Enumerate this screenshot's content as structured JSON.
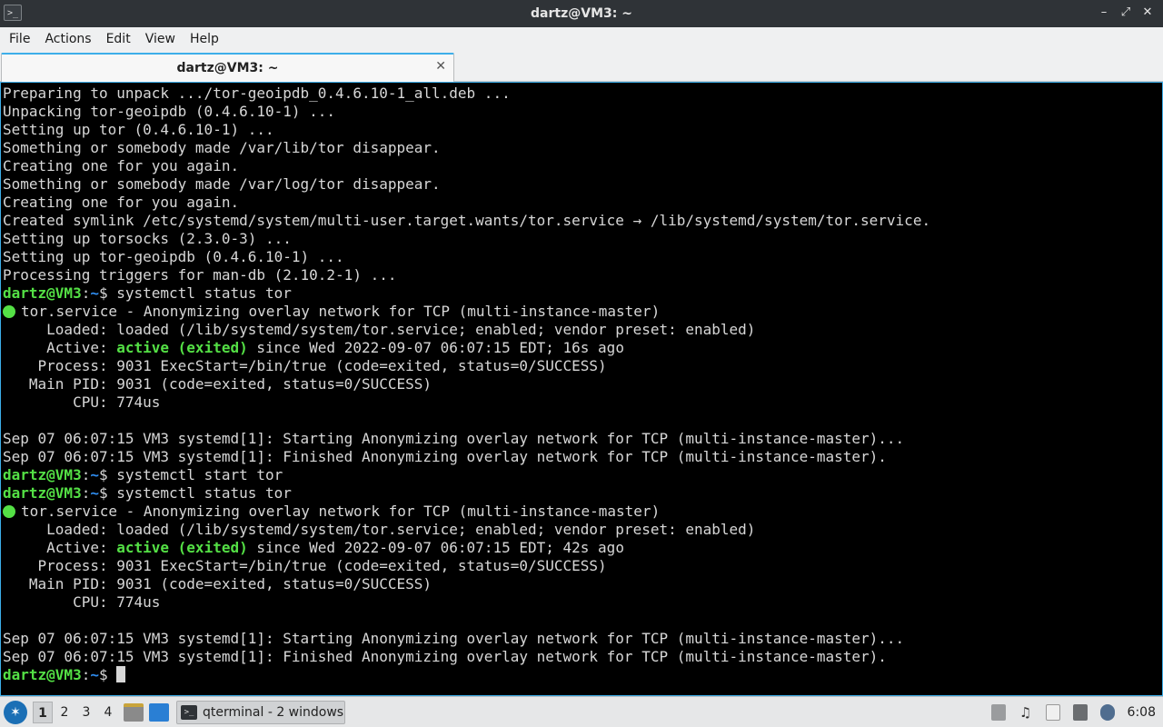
{
  "window": {
    "title": "dartz@VM3: ~",
    "app_icon_glyph": ">_",
    "controls": {
      "minimize": "–",
      "restore": "⤢",
      "close": "✕"
    }
  },
  "menu": [
    "File",
    "Actions",
    "Edit",
    "View",
    "Help"
  ],
  "tab": {
    "label": "dartz@VM3: ~",
    "close_glyph": "✕"
  },
  "terminal": {
    "colors": {
      "background": "#000000",
      "text": "#d7d7d7",
      "prompt_user": "#54e045",
      "prompt_path": "#2f8df0",
      "status_active": "#54e045"
    },
    "prompt": {
      "user_host": "dartz@VM3",
      "sep": ":",
      "path": "~",
      "symbol": "$"
    },
    "lines": [
      {
        "t": "Preparing to unpack .../tor-geoipdb_0.4.6.10-1_all.deb ..."
      },
      {
        "t": "Unpacking tor-geoipdb (0.4.6.10-1) ..."
      },
      {
        "t": "Setting up tor (0.4.6.10-1) ..."
      },
      {
        "t": "Something or somebody made /var/lib/tor disappear."
      },
      {
        "t": "Creating one for you again."
      },
      {
        "t": "Something or somebody made /var/log/tor disappear."
      },
      {
        "t": "Creating one for you again."
      },
      {
        "t": "Created symlink /etc/systemd/system/multi-user.target.wants/tor.service → /lib/systemd/system/tor.service."
      },
      {
        "t": "Setting up torsocks (2.3.0-3) ..."
      },
      {
        "t": "Setting up tor-geoipdb (0.4.6.10-1) ..."
      },
      {
        "t": "Processing triggers for man-db (2.10.2-1) ..."
      },
      {
        "type": "prompt",
        "cmd": " systemctl status tor"
      },
      {
        "type": "unit",
        "t": "tor.service - Anonymizing overlay network for TCP (multi-instance-master)"
      },
      {
        "t": "     Loaded: loaded (/lib/systemd/system/tor.service; enabled; vendor preset: enabled)"
      },
      {
        "type": "active",
        "pre": "     Active: ",
        "status": "active (exited)",
        "post": " since Wed 2022-09-07 06:07:15 EDT; 16s ago"
      },
      {
        "t": "    Process: 9031 ExecStart=/bin/true (code=exited, status=0/SUCCESS)"
      },
      {
        "t": "   Main PID: 9031 (code=exited, status=0/SUCCESS)"
      },
      {
        "t": "        CPU: 774us"
      },
      {
        "t": ""
      },
      {
        "t": "Sep 07 06:07:15 VM3 systemd[1]: Starting Anonymizing overlay network for TCP (multi-instance-master)..."
      },
      {
        "t": "Sep 07 06:07:15 VM3 systemd[1]: Finished Anonymizing overlay network for TCP (multi-instance-master)."
      },
      {
        "type": "prompt",
        "cmd": " systemctl start tor"
      },
      {
        "type": "prompt",
        "cmd": " systemctl status tor"
      },
      {
        "type": "unit",
        "t": "tor.service - Anonymizing overlay network for TCP (multi-instance-master)"
      },
      {
        "t": "     Loaded: loaded (/lib/systemd/system/tor.service; enabled; vendor preset: enabled)"
      },
      {
        "type": "active",
        "pre": "     Active: ",
        "status": "active (exited)",
        "post": " since Wed 2022-09-07 06:07:15 EDT; 42s ago"
      },
      {
        "t": "    Process: 9031 ExecStart=/bin/true (code=exited, status=0/SUCCESS)"
      },
      {
        "t": "   Main PID: 9031 (code=exited, status=0/SUCCESS)"
      },
      {
        "t": "        CPU: 774us"
      },
      {
        "t": ""
      },
      {
        "t": "Sep 07 06:07:15 VM3 systemd[1]: Starting Anonymizing overlay network for TCP (multi-instance-master)..."
      },
      {
        "t": "Sep 07 06:07:15 VM3 systemd[1]: Finished Anonymizing overlay network for TCP (multi-instance-master)."
      },
      {
        "type": "prompt",
        "cmd": " ",
        "cursor": true
      }
    ]
  },
  "taskbar": {
    "start_glyph": "✶",
    "desktops": [
      "1",
      "2",
      "3",
      "4"
    ],
    "active_desktop": "1",
    "task_label": "qterminal - 2 windows",
    "task_icon_glyph": ">_",
    "volume_glyph": "♫",
    "clock": "6:08"
  }
}
